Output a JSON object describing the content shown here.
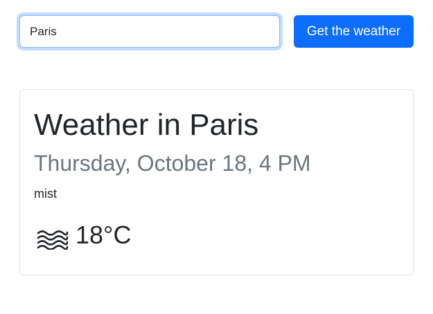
{
  "search": {
    "value": "Paris",
    "button_label": "Get the weather"
  },
  "weather": {
    "title": "Weather in Paris",
    "datetime": "Thursday, October 18, 4 PM",
    "description": "mist",
    "icon": "mist-icon",
    "temperature": "18°C"
  },
  "colors": {
    "primary": "#0d6efd",
    "muted_text": "#6c757d",
    "border": "#dee2e6",
    "focus_border": "#86b7fe"
  }
}
